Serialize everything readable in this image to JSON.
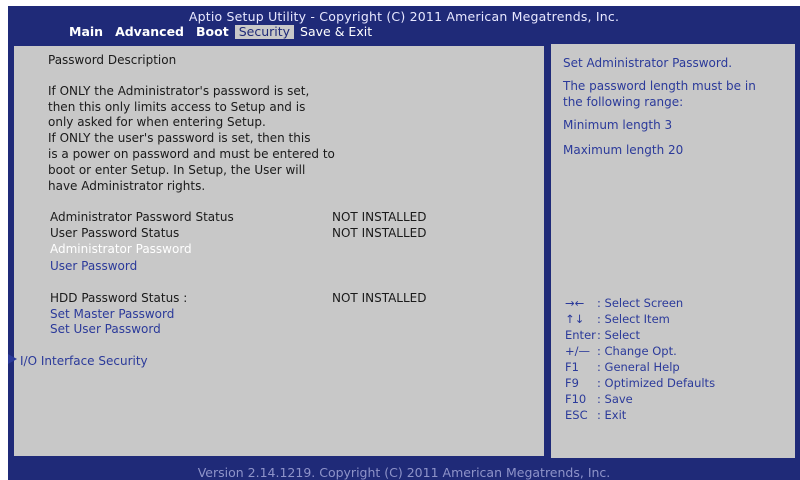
{
  "header": {
    "title": "Aptio Setup Utility - Copyright (C) 2011 American Megatrends, Inc.",
    "tabs": [
      "Main",
      "Advanced",
      "Boot",
      "Security",
      "Save & Exit"
    ]
  },
  "description": [
    "Password Description",
    "If ONLY the Administrator's password is set,",
    "then this only limits access to Setup and is",
    "only asked for when entering Setup.",
    "If ONLY the user's password is set, then this",
    "is a power on password and must be entered to",
    "boot or enter Setup. In Setup, the User will",
    "have Administrator rights."
  ],
  "status": {
    "admin_label": "Administrator Password Status",
    "admin_value": "NOT INSTALLED",
    "user_label": "User Password Status",
    "user_value": "NOT INSTALLED",
    "hdd_label": "HDD Password Status :",
    "hdd_value": "NOT INSTALLED"
  },
  "items": {
    "admin_password": "Administrator Password",
    "user_password": "User Password",
    "set_master": "Set Master Password",
    "set_user": "Set User Password",
    "io_security": "I/O Interface Security"
  },
  "help": [
    "Set Administrator Password.",
    "The password length must be in",
    "the following range:",
    "Minimum length 3",
    "Maximum length 20"
  ],
  "keys": [
    {
      "key": "→←",
      "desc": ": Select Screen"
    },
    {
      "key": "↑↓",
      "desc": ": Select Item"
    },
    {
      "key": "Enter",
      "desc": ": Select"
    },
    {
      "key": "+/—",
      "desc": ": Change Opt."
    },
    {
      "key": "F1",
      "desc": ": General Help"
    },
    {
      "key": "F9",
      "desc": ": Optimized Defaults"
    },
    {
      "key": "F10",
      "desc": ": Save"
    },
    {
      "key": "ESC",
      "desc": ": Exit"
    }
  ],
  "footer": "Version 2.14.1219. Copyright (C) 2011 American Megatrends, Inc.",
  "colors": {
    "frame": "#1f2a78",
    "panel": "#c8c8c8",
    "accent": "#2b3a9a"
  }
}
